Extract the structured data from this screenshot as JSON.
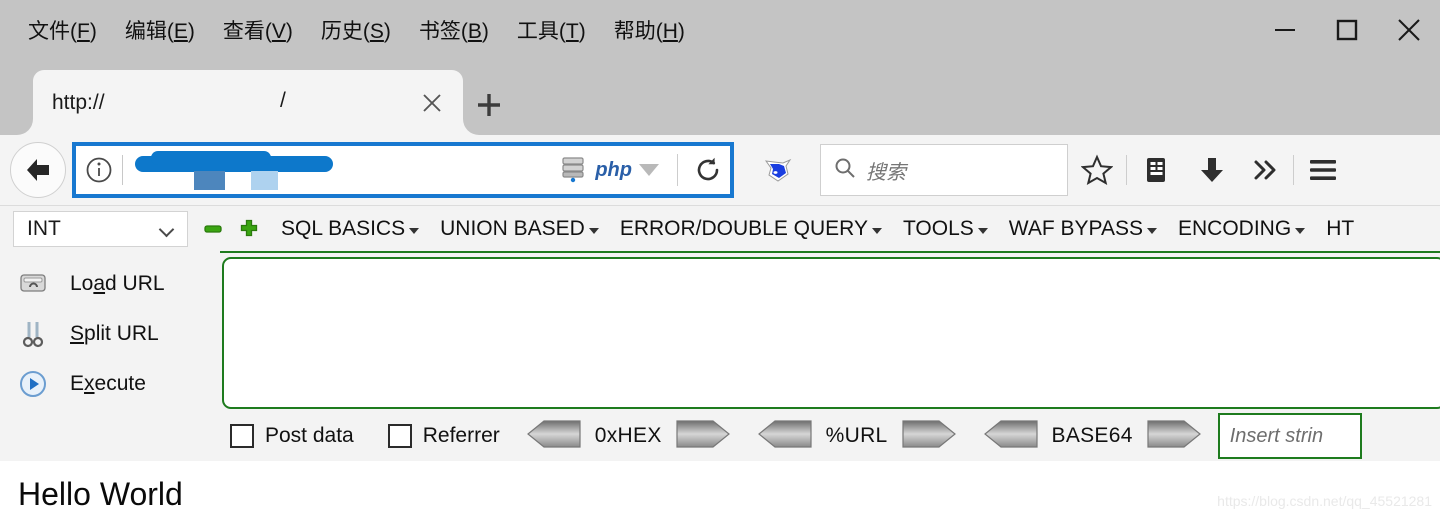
{
  "window": {
    "menu": [
      {
        "text": "文件",
        "mnemonic": "F"
      },
      {
        "text": "编辑",
        "mnemonic": "E"
      },
      {
        "text": "查看",
        "mnemonic": "V"
      },
      {
        "text": "历史",
        "mnemonic": "S"
      },
      {
        "text": "书签",
        "mnemonic": "B"
      },
      {
        "text": "工具",
        "mnemonic": "T"
      },
      {
        "text": "帮助",
        "mnemonic": "H"
      }
    ],
    "controls": {
      "minimize": "minimize-button",
      "maximize": "maximize-button",
      "close": "close-button"
    }
  },
  "tabs": {
    "active": {
      "title": "http://",
      "path": "/",
      "close_label": "×"
    },
    "new_tab_label": "+"
  },
  "navbar": {
    "back_label": "back-arrow",
    "identity_icon": "info-circle-icon",
    "url_value": "",
    "url_redacted": true,
    "php_label": "php",
    "reload_label": "reload-icon",
    "extension_icon": "fox-head-icon",
    "search_placeholder": "搜索",
    "icons": [
      "bookmark-star-icon",
      "library-icon",
      "downloads-icon",
      "overflow-chevrons-icon",
      "hamburger-menu-icon"
    ],
    "url_border_color": "#1878d0",
    "php_text_color": "#2a5fa8"
  },
  "hackbar": {
    "type_select": {
      "value": "INT"
    },
    "zoom_out_icon": "minus-icon",
    "zoom_in_icon": "plus-icon",
    "menus": [
      {
        "label": "SQL BASICS"
      },
      {
        "label": "UNION BASED"
      },
      {
        "label": "ERROR/DOUBLE QUERY"
      },
      {
        "label": "TOOLS"
      },
      {
        "label": "WAF BYPASS"
      },
      {
        "label": "ENCODING"
      },
      {
        "label": "HT"
      }
    ],
    "actions": [
      {
        "pre": "Lo",
        "mn": "a",
        "post": "d URL",
        "icon": "load-url-icon"
      },
      {
        "pre": "",
        "mn": "S",
        "post": "plit URL",
        "icon": "split-url-icon"
      },
      {
        "pre": "E",
        "mn": "x",
        "post": "ecute",
        "icon": "execute-icon"
      }
    ],
    "textarea_value": "",
    "checkboxes": [
      {
        "label": "Post data",
        "checked": false
      },
      {
        "label": "Referrer",
        "checked": false
      }
    ],
    "encoders": [
      {
        "label": "0xHEX"
      },
      {
        "label": "%URL"
      },
      {
        "label": "BASE64"
      }
    ],
    "insert_placeholder": "Insert strin",
    "accent_color": "#1e7b1e"
  },
  "content": {
    "heading": "Hello World",
    "watermark": "https://blog.csdn.net/qq_45521281"
  }
}
